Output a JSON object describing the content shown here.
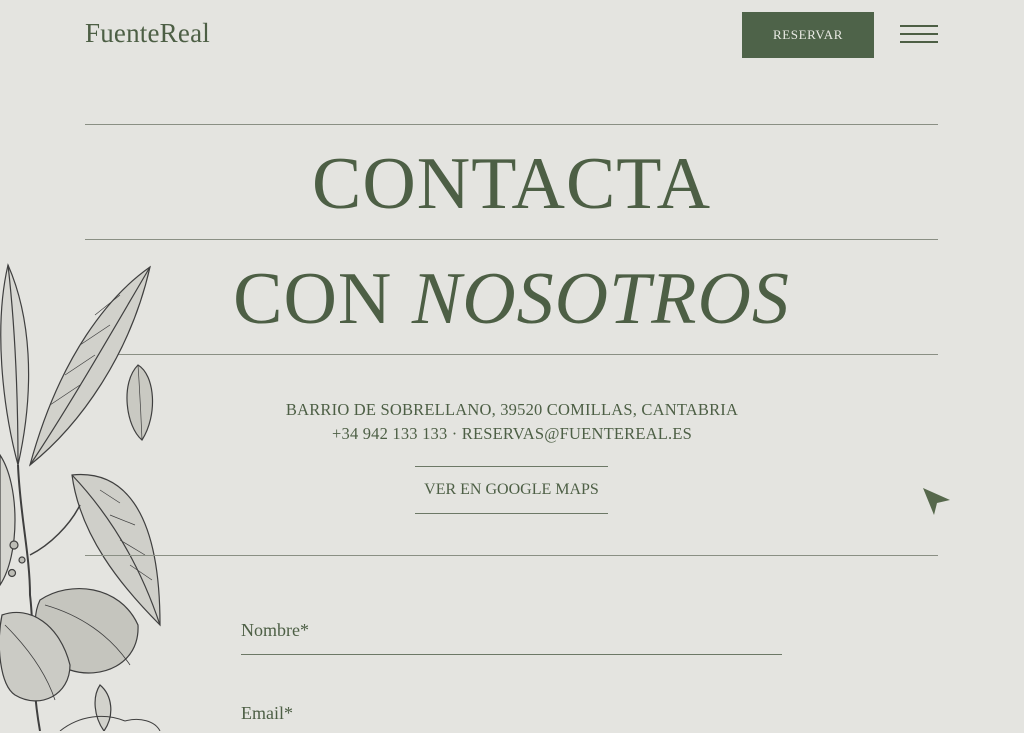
{
  "header": {
    "logo": "FuenteReal",
    "reserve_label": "RESERVAR",
    "menu_icon": "hamburger-menu-icon"
  },
  "hero": {
    "title_line1": "CONTACTA",
    "title_line2_plain": "CON",
    "title_line2_italic": "NOSOTROS"
  },
  "contact": {
    "address": "BARRIO DE SOBRELLANO, 39520 COMILLAS, CANTABRIA",
    "phone": "+34 942 133 133",
    "separator": "·",
    "email": "RESERVAS@FUENTEREAL.ES",
    "maps_label": "VER EN GOOGLE MAPS"
  },
  "form": {
    "name_label": "Nombre*",
    "email_label": "Email*"
  },
  "colors": {
    "background": "#e4e4e0",
    "accent": "#4e6349",
    "text": "#4d5f45"
  }
}
